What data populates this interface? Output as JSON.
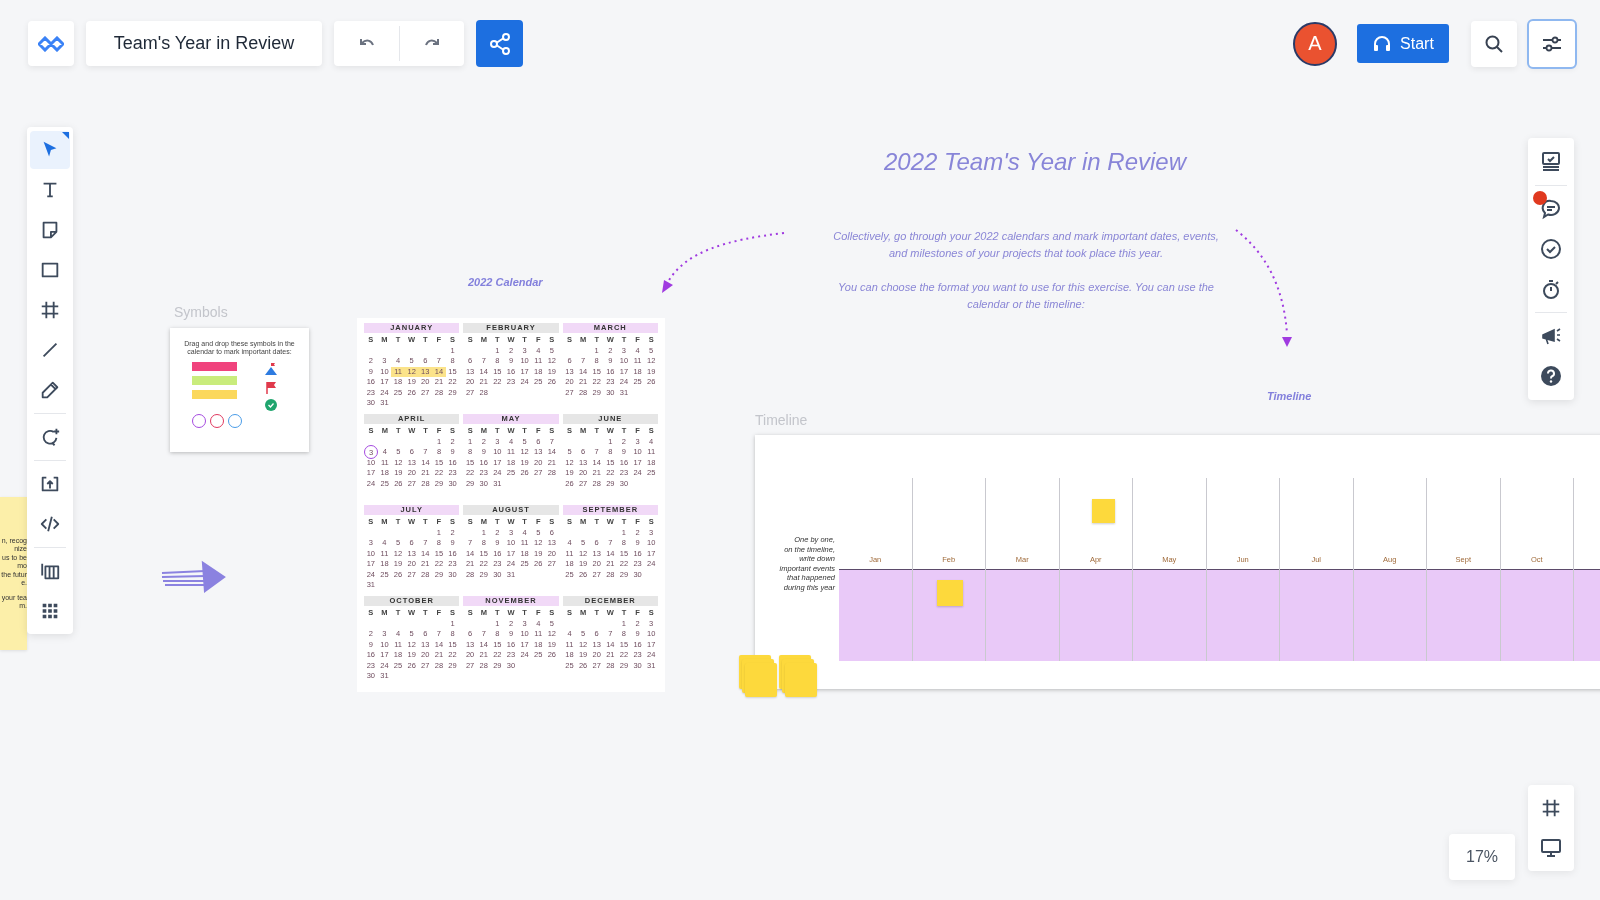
{
  "topbar": {
    "board_title": "Team's Year in Review",
    "avatar": "A",
    "start_button": "Start",
    "settings_button": {
      "selected": true
    }
  },
  "left_toolbar": [
    [
      {
        "kind": "select",
        "selected": true
      },
      {
        "kind": "text",
        "selected": false
      },
      {
        "kind": "sticky",
        "selected": false
      },
      {
        "kind": "rect",
        "selected": false
      },
      {
        "kind": "frame",
        "selected": false
      },
      {
        "kind": "line",
        "selected": false
      },
      {
        "kind": "pen",
        "selected": false
      }
    ],
    [
      {
        "kind": "comment",
        "selected": false
      }
    ],
    [
      {
        "kind": "upload",
        "selected": false
      },
      {
        "kind": "embed",
        "selected": false
      }
    ],
    [
      {
        "kind": "table",
        "selected": false
      },
      {
        "kind": "apps",
        "selected": false
      }
    ]
  ],
  "right_toolbar": {
    "comments_notification": true
  },
  "canvas": {
    "title": "2022 Team's Year in Review",
    "description": [
      "Collectively, go through your 2022 calendars and mark important dates, events, and milestones of your projects that took place this year.",
      "You can choose the format you want to use for this exercise. You can use the calendar or the timeline:"
    ],
    "calendar_caption": "2022 Calendar",
    "timeline_caption": "Timeline",
    "side_note_lines": [
      "n, recognize",
      "us to be mo",
      "the future.",
      "your team."
    ],
    "symbols": {
      "label": "Symbols",
      "instruction": "Drag and drop these symbols in the calendar to mark important dates:"
    },
    "calendar": {
      "months": [
        {
          "name": "JANUARY",
          "color": "#f1d9f7",
          "weekdays": [
            "S",
            "M",
            "T",
            "W",
            "T",
            "F",
            "S"
          ],
          "weeks": [
            [
              "1"
            ],
            [
              "2",
              "3",
              "4",
              "5",
              "6",
              "7",
              "8"
            ],
            [
              "9",
              "10",
              {
                "day": "11",
                "highlighted": true
              },
              {
                "day": "12",
                "highlighted": true
              },
              {
                "day": "13",
                "highlighted": true
              },
              {
                "day": "14",
                "highlighted": true
              },
              "15"
            ],
            [
              "16",
              "17",
              "18",
              "19",
              "20",
              "21",
              "22"
            ],
            [
              "23",
              "24",
              "25",
              "26",
              "27",
              "28",
              "29"
            ],
            [
              "30",
              "31"
            ]
          ]
        },
        {
          "name": "FEBRUARY",
          "color": "#e6e6e6",
          "weekdays": [
            "S",
            "M",
            "T",
            "W",
            "T",
            "F",
            "S"
          ],
          "weeks": [
            [
              "1",
              "2",
              "3",
              "4",
              "5"
            ],
            [
              "6",
              "7",
              "8",
              "9",
              "10",
              "11",
              "12"
            ],
            [
              "13",
              "14",
              "15",
              "16",
              "17",
              "18",
              "19"
            ],
            [
              "20",
              "21",
              "22",
              "23",
              "24",
              "25",
              "26"
            ],
            [
              "27",
              "28"
            ]
          ]
        },
        {
          "name": "MARCH",
          "color": "#f1d9f7",
          "weekdays": [
            "S",
            "M",
            "T",
            "W",
            "T",
            "F",
            "S"
          ],
          "weeks": [
            [
              "1",
              "2",
              "3",
              "4",
              "5"
            ],
            [
              "6",
              "7",
              "8",
              "9",
              "10",
              "11",
              "12"
            ],
            [
              "13",
              "14",
              "15",
              "16",
              "17",
              "18",
              "19"
            ],
            [
              "20",
              "21",
              "22",
              "23",
              "24",
              "25",
              "26"
            ],
            [
              "27",
              "28",
              "29",
              "30",
              "31"
            ]
          ]
        },
        {
          "name": "APRIL",
          "color": "#e6e6e6",
          "weekdays": [
            "S",
            "M",
            "T",
            "W",
            "T",
            "F",
            "S"
          ],
          "weeks": [
            [
              "1",
              "2"
            ],
            [
              {
                "day": "3",
                "circled": true
              },
              "4",
              "5",
              "6",
              "7",
              "8",
              "9"
            ],
            [
              "10",
              "11",
              "12",
              "13",
              "14",
              "15",
              "16"
            ],
            [
              "17",
              "18",
              "19",
              "20",
              "21",
              "22",
              "23"
            ],
            [
              "24",
              "25",
              "26",
              "27",
              "28",
              "29",
              "30"
            ]
          ]
        },
        {
          "name": "MAY",
          "color": "#f1d9f7",
          "weekdays": [
            "S",
            "M",
            "T",
            "W",
            "T",
            "F",
            "S"
          ],
          "weeks": [
            [
              "1",
              "2",
              "3",
              "4",
              "5",
              "6",
              "7"
            ],
            [
              "8",
              "9",
              "10",
              "11",
              "12",
              "13",
              "14"
            ],
            [
              "15",
              "16",
              "17",
              "18",
              "19",
              "20",
              "21"
            ],
            [
              "22",
              "23",
              "24",
              "25",
              "26",
              "27",
              "28"
            ],
            [
              "29",
              "30",
              "31"
            ]
          ]
        },
        {
          "name": "JUNE",
          "color": "#e6e6e6",
          "weekdays": [
            "S",
            "M",
            "T",
            "W",
            "T",
            "F",
            "S"
          ],
          "weeks": [
            [
              "1",
              "2",
              "3",
              "4"
            ],
            [
              "5",
              "6",
              "7",
              "8",
              "9",
              "10",
              "11"
            ],
            [
              "12",
              "13",
              "14",
              "15",
              "16",
              "17",
              "18"
            ],
            [
              "19",
              "20",
              "21",
              "22",
              "23",
              "24",
              "25"
            ],
            [
              "26",
              "27",
              "28",
              "29",
              "30"
            ]
          ]
        },
        {
          "name": "JULY",
          "color": "#f1d9f7",
          "weekdays": [
            "S",
            "M",
            "T",
            "W",
            "T",
            "F",
            "S"
          ],
          "weeks": [
            [
              "1",
              "2"
            ],
            [
              "3",
              "4",
              "5",
              "6",
              "7",
              "8",
              "9"
            ],
            [
              "10",
              "11",
              "12",
              "13",
              "14",
              "15",
              "16"
            ],
            [
              "17",
              "18",
              "19",
              "20",
              "21",
              "22",
              "23"
            ],
            [
              "24",
              "25",
              "26",
              "27",
              "28",
              "29",
              "30"
            ],
            [
              "31"
            ]
          ]
        },
        {
          "name": "AUGUST",
          "color": "#e6e6e6",
          "weekdays": [
            "S",
            "M",
            "T",
            "W",
            "T",
            "F",
            "S"
          ],
          "weeks": [
            [
              "1",
              "2",
              "3",
              "4",
              "5",
              "6"
            ],
            [
              "7",
              "8",
              "9",
              "10",
              "11",
              "12",
              "13"
            ],
            [
              "14",
              "15",
              "16",
              "17",
              "18",
              "19",
              "20"
            ],
            [
              "21",
              "22",
              "23",
              "24",
              "25",
              "26",
              "27"
            ],
            [
              "28",
              "29",
              "30",
              "31"
            ]
          ]
        },
        {
          "name": "SEPTEMBER",
          "color": "#f1d9f7",
          "weekdays": [
            "S",
            "M",
            "T",
            "W",
            "T",
            "F",
            "S"
          ],
          "weeks": [
            [
              "1",
              "2",
              "3"
            ],
            [
              "4",
              "5",
              "6",
              "7",
              "8",
              "9",
              "10"
            ],
            [
              "11",
              "12",
              "13",
              "14",
              "15",
              "16",
              "17"
            ],
            [
              "18",
              "19",
              "20",
              "21",
              "22",
              "23",
              "24"
            ],
            [
              "25",
              "26",
              "27",
              "28",
              "29",
              "30"
            ]
          ]
        },
        {
          "name": "OCTOBER",
          "color": "#e6e6e6",
          "weekdays": [
            "S",
            "M",
            "T",
            "W",
            "T",
            "F",
            "S"
          ],
          "weeks": [
            [
              "1"
            ],
            [
              "2",
              "3",
              "4",
              "5",
              "6",
              "7",
              "8"
            ],
            [
              "9",
              "10",
              "11",
              "12",
              "13",
              "14",
              "15"
            ],
            [
              "16",
              "17",
              "18",
              "19",
              "20",
              "21",
              "22"
            ],
            [
              "23",
              "24",
              "25",
              "26",
              "27",
              "28",
              "29"
            ],
            [
              "30",
              "31"
            ]
          ]
        },
        {
          "name": "NOVEMBER",
          "color": "#f1d9f7",
          "weekdays": [
            "S",
            "M",
            "T",
            "W",
            "T",
            "F",
            "S"
          ],
          "weeks": [
            [
              "1",
              "2",
              "3",
              "4",
              "5"
            ],
            [
              "6",
              "7",
              "8",
              "9",
              "10",
              "11",
              "12"
            ],
            [
              "13",
              "14",
              "15",
              "16",
              "17",
              "18",
              "19"
            ],
            [
              "20",
              "21",
              "22",
              "23",
              "24",
              "25",
              "26"
            ],
            [
              "27",
              "28",
              "29",
              "30"
            ]
          ]
        },
        {
          "name": "DECEMBER",
          "color": "#e6e6e6",
          "weekdays": [
            "S",
            "M",
            "T",
            "W",
            "T",
            "F",
            "S"
          ],
          "weeks": [
            [
              "1",
              "2",
              "3"
            ],
            [
              "4",
              "5",
              "6",
              "7",
              "8",
              "9",
              "10"
            ],
            [
              "11",
              "12",
              "13",
              "14",
              "15",
              "16",
              "17"
            ],
            [
              "18",
              "19",
              "20",
              "21",
              "22",
              "23",
              "24"
            ],
            [
              "25",
              "26",
              "27",
              "28",
              "29",
              "30",
              "31"
            ]
          ]
        }
      ]
    },
    "timeline": {
      "label": "Timeline",
      "instruction": "One by one,\non the timeline,\nwrite down\nimportant events\nthat happened\nduring this year",
      "months": [
        {
          "label": "Jan"
        },
        {
          "label": "Feb",
          "sticky_below": true
        },
        {
          "label": "Mar"
        },
        {
          "label": "Apr",
          "sticky_above": true
        },
        {
          "label": "May"
        },
        {
          "label": "Jun"
        },
        {
          "label": "Jul"
        },
        {
          "label": "Aug"
        },
        {
          "label": "Sept"
        },
        {
          "label": "Oct"
        }
      ]
    }
  },
  "zoom": "17%"
}
